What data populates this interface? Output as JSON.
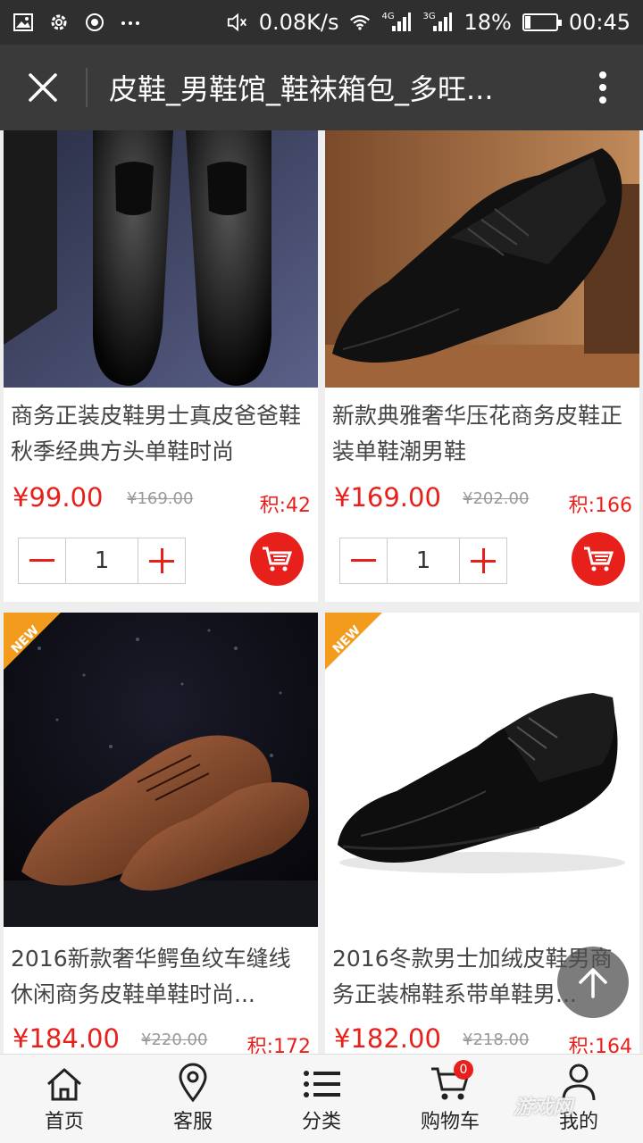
{
  "status_bar": {
    "network_speed": "0.08K/s",
    "net_4g": "4G",
    "net_3g": "3G",
    "battery_percent_text": "18%",
    "battery_level": 0.18,
    "time": "00:45"
  },
  "title_bar": {
    "title": "皮鞋_男鞋馆_鞋袜箱包_多旺..."
  },
  "products": [
    {
      "name": "商务正装皮鞋男士真皮爸爸鞋秋季经典方头单鞋时尚",
      "price": "¥99.00",
      "old_price": "¥169.00",
      "points": "积:42",
      "qty": "1",
      "is_new": false
    },
    {
      "name": "新款典雅奢华压花商务皮鞋正装单鞋潮男鞋",
      "price": "¥169.00",
      "old_price": "¥202.00",
      "points": "积:166",
      "qty": "1",
      "is_new": false
    },
    {
      "name": "2016新款奢华鳄鱼纹车缝线休闲商务皮鞋单鞋时尚...",
      "price": "¥184.00",
      "old_price": "¥220.00",
      "points": "积:172",
      "qty": "1",
      "is_new": true
    },
    {
      "name": "2016冬款男士加绒皮鞋男商务正装棉鞋系带单鞋男...",
      "price": "¥182.00",
      "old_price": "¥218.00",
      "points": "积:164",
      "qty": "1",
      "is_new": true
    }
  ],
  "new_tag_label": "NEW",
  "tabs": [
    {
      "label": "首页",
      "icon": "home-icon"
    },
    {
      "label": "客服",
      "icon": "location-pin-icon"
    },
    {
      "label": "分类",
      "icon": "list-icon"
    },
    {
      "label": "购物车",
      "icon": "cart-icon",
      "badge": "0"
    },
    {
      "label": "我的",
      "icon": "user-icon"
    }
  ],
  "watermark": "游戏网",
  "colors": {
    "accent": "#e8201c",
    "title_bar": "#3a3a3a",
    "status_bar": "#2f2f2f",
    "new_tag": "#f29b1d"
  }
}
